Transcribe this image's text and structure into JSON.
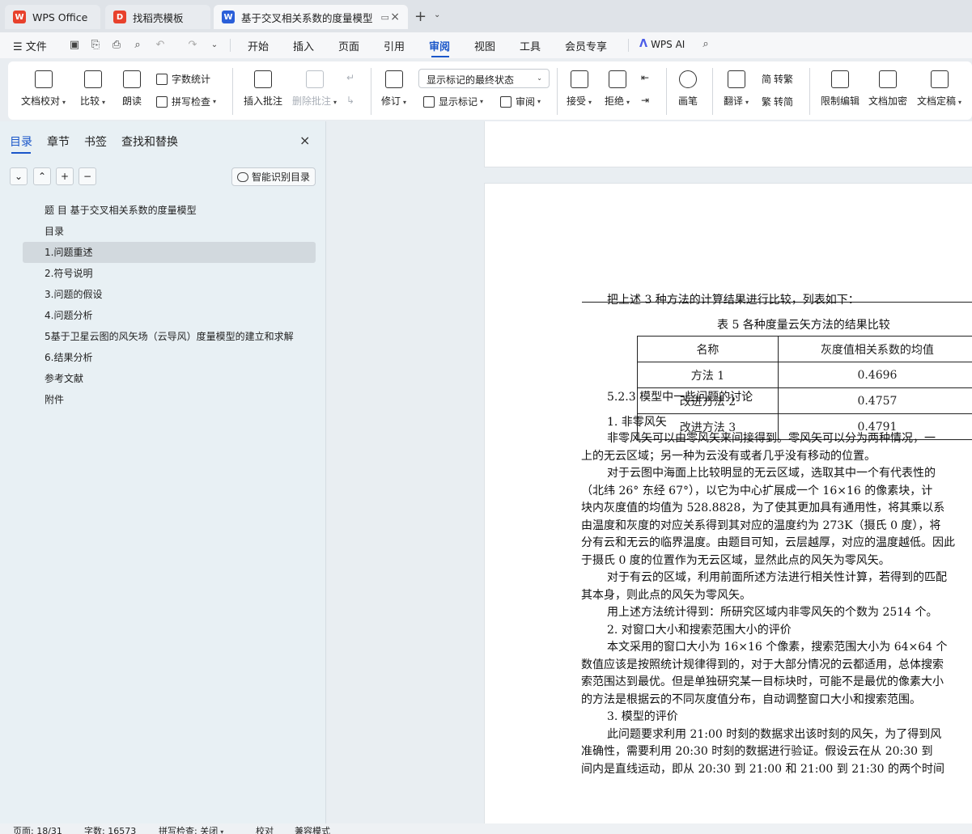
{
  "tabs": [
    {
      "label": "WPS Office",
      "icon": "wps-logo-icon"
    },
    {
      "label": "找稻壳模板",
      "icon": "docer-icon"
    },
    {
      "label": "基于交叉相关系数的度量模型",
      "icon": "word-doc-icon"
    }
  ],
  "menu": {
    "file": "文件",
    "items": [
      "开始",
      "插入",
      "页面",
      "引用",
      "审阅",
      "视图",
      "工具",
      "会员专享"
    ],
    "active": "审阅",
    "wps_ai": "WPS AI"
  },
  "ribbon": {
    "doc_proof": "文档校对",
    "compare": "比较",
    "read_aloud": "朗读",
    "word_count": "字数统计",
    "spell_check": "拼写检查",
    "insert_comment": "插入批注",
    "delete_comment": "删除批注",
    "track_changes": "修订",
    "markup_state": "显示标记的最终状态",
    "show_markup": "显示标记",
    "review": "审阅",
    "accept": "接受",
    "reject": "拒绝",
    "ink": "画笔",
    "translate": "翻译",
    "to_traditional": "转繁",
    "to_simplified": "转简",
    "restrict_edit": "限制编辑",
    "encrypt": "文档加密",
    "finalize": "文档定稿"
  },
  "sidebar": {
    "tabs": [
      "目录",
      "章节",
      "书签",
      "查找和替换"
    ],
    "smart_toc": "智能识别目录",
    "toc": [
      "题 目 基于交叉相关系数的度量模型",
      "目录",
      "1.问题重述",
      "2.符号说明",
      "3.问题的假设",
      "4.问题分析",
      "5基于卫星云图的风矢场（云导风）度量模型的建立和求解",
      "6.结果分析",
      "参考文献",
      "附件"
    ],
    "selected_index": 2
  },
  "document": {
    "intro": "把上述 3 种方法的计算结果进行比较，列表如下：",
    "table_caption": "表 5 各种度量云矢方法的结果比较",
    "table_headers": [
      "名称",
      "灰度值相关系数的均值"
    ],
    "table_rows": [
      [
        "方法 1",
        "0.4696"
      ],
      [
        "改进方法 2",
        "0.4757"
      ],
      [
        "改进方法 3",
        "0.4791"
      ]
    ],
    "lines": [
      "5.2.3 模型中一些问题的讨论",
      "1. 非零风矢",
      "非零风矢可以由零风矢来间接得到。零风矢可以分为两种情况，一",
      "上的无云区域；另一种为云没有或者几乎没有移动的位置。",
      "对于云图中海面上比较明显的无云区域，选取其中一个有代表性的",
      "（北纬 26° 东经 67°），以它为中心扩展成一个 16×16 的像素块，计",
      "块内灰度值的均值为 528.8828，为了使其更加具有通用性，将其乘以系",
      "由温度和灰度的对应关系得到其对应的温度约为 273K（摄氏 0 度），将",
      "分有云和无云的临界温度。由题目可知，云层越厚，对应的温度越低。因此",
      "于摄氏 0 度的位置作为无云区域，显然此点的风矢为零风矢。",
      "对于有云的区域，利用前面所述方法进行相关性计算，若得到的匹配",
      "其本身，则此点的风矢为零风矢。",
      "用上述方法统计得到：所研究区域内非零风矢的个数为 2514 个。",
      "2. 对窗口大小和搜索范围大小的评价",
      "本文采用的窗口大小为 16×16 个像素，搜索范围大小为 64×64 个",
      "数值应该是按照统计规律得到的，对于大部分情况的云都适用，总体搜索",
      "索范围达到最优。但是单独研究某一目标块时，可能不是最优的像素大小",
      "的方法是根据云的不同灰度值分布，自动调整窗口大小和搜索范围。",
      "3. 模型的评价",
      "此问题要求利用 21:00 时刻的数据求出该时刻的风矢，为了得到风",
      "准确性，需要利用 20:30 时刻的数据进行验证。假设云在从 20:30 到",
      "间内是直线运动，即从 20:30 到 21:00 和 21:00 到 21:30 的两个时间"
    ]
  },
  "status": {
    "page": "页面: 18/31",
    "words": "字数: 16573",
    "spell": "拼写检查: 关闭",
    "proof": "校对",
    "compat": "兼容模式"
  }
}
